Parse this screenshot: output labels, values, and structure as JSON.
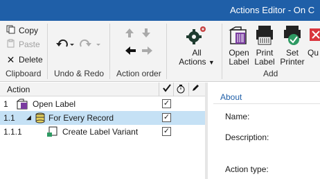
{
  "window": {
    "title": "Actions Editor - On C"
  },
  "ribbon": {
    "clipboard": {
      "copy_label": "Copy",
      "paste_label": "Paste",
      "delete_label": "Delete",
      "group_label": "Clipboard"
    },
    "undo_redo": {
      "group_label": "Undo & Redo"
    },
    "action_order": {
      "group_label": "Action order"
    },
    "all_actions": {
      "line1": "All",
      "line2": "Actions"
    },
    "add": {
      "group_label": "Add",
      "items": [
        {
          "line1": "Open",
          "line2": "Label"
        },
        {
          "line1": "Print",
          "line2": "Label"
        },
        {
          "line1": "Set",
          "line2": "Printer"
        },
        {
          "line1": "Qu",
          "line2": ""
        }
      ]
    }
  },
  "tree": {
    "header": {
      "action": "Action"
    },
    "rows": [
      {
        "num": "1",
        "label": "Open Label"
      },
      {
        "num": "1.1",
        "label": "For Every Record"
      },
      {
        "num": "1.1.1",
        "label": "Create Label Variant"
      }
    ]
  },
  "details": {
    "tab": "About",
    "name_label": "Name:",
    "description_label": "Description:",
    "action_type_label": "Action type:"
  },
  "colors": {
    "titlebar": "#1f5fa8",
    "selection": "#c5e1f5",
    "accent": "#1f5fa8"
  }
}
